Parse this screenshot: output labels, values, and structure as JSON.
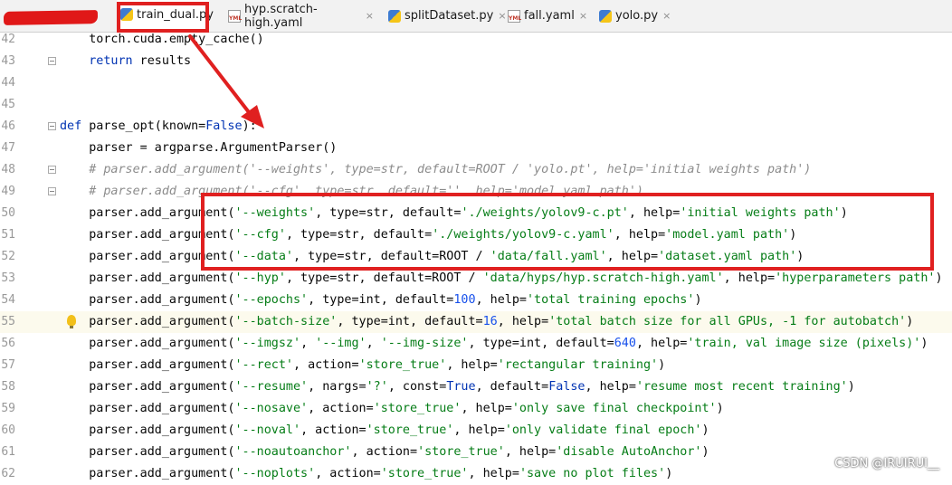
{
  "tabs": [
    {
      "label": "train_dual.py",
      "type": "py",
      "active": true
    },
    {
      "label": "hyp.scratch-high.yaml",
      "type": "yaml",
      "active": false
    },
    {
      "label": "splitDataset.py",
      "type": "py",
      "active": false
    },
    {
      "label": "fall.yaml",
      "type": "yaml",
      "active": false
    },
    {
      "label": "yolo.py",
      "type": "py",
      "active": false
    }
  ],
  "tab_close_glyph": "×",
  "yaml_icon_text": "YML",
  "lines": [
    {
      "n": "42",
      "indent": "    ",
      "tokens": [
        [
          "t",
          "torch.cuda.empty_cache()"
        ]
      ]
    },
    {
      "n": "43",
      "indent": "    ",
      "fold": true,
      "tokens": [
        [
          "kw",
          "return"
        ],
        [
          "t",
          " results"
        ]
      ]
    },
    {
      "n": "44",
      "indent": "",
      "tokens": []
    },
    {
      "n": "45",
      "indent": "",
      "tokens": []
    },
    {
      "n": "46",
      "indent": "",
      "fold": true,
      "tokens": [
        [
          "kw",
          "def"
        ],
        [
          "t",
          " parse_opt(known="
        ],
        [
          "kw",
          "False"
        ],
        [
          "t",
          "):"
        ]
      ]
    },
    {
      "n": "47",
      "indent": "    ",
      "tokens": [
        [
          "t",
          "parser = argparse.ArgumentParser()"
        ]
      ]
    },
    {
      "n": "48",
      "indent": "    ",
      "fold": true,
      "tokens": [
        [
          "cmt",
          "# parser.add_argument('--weights', type=str, default=ROOT / 'yolo.pt', help='initial weights path')"
        ]
      ]
    },
    {
      "n": "49",
      "indent": "    ",
      "fold": true,
      "tokens": [
        [
          "cmt",
          "# parser.add_argument('--cfg', type=str, default='', help='model.yaml path')"
        ]
      ]
    },
    {
      "n": "50",
      "indent": "    ",
      "tokens": [
        [
          "t",
          "parser.add_argument("
        ],
        [
          "str",
          "'--weights'"
        ],
        [
          "t",
          ", type=str, default="
        ],
        [
          "str",
          "'./weights/yolov9-c.pt'"
        ],
        [
          "t",
          ", help="
        ],
        [
          "str",
          "'initial weights path'"
        ],
        [
          "t",
          ")"
        ]
      ]
    },
    {
      "n": "51",
      "indent": "    ",
      "tokens": [
        [
          "t",
          "parser.add_argument("
        ],
        [
          "str",
          "'--cfg'"
        ],
        [
          "t",
          ", type=str, default="
        ],
        [
          "str",
          "'./weights/yolov9-c.yaml'"
        ],
        [
          "t",
          ", help="
        ],
        [
          "str",
          "'model.yaml path'"
        ],
        [
          "t",
          ")"
        ]
      ]
    },
    {
      "n": "52",
      "indent": "    ",
      "tokens": [
        [
          "t",
          "parser.add_argument("
        ],
        [
          "str",
          "'--data'"
        ],
        [
          "t",
          ", type=str, default=ROOT / "
        ],
        [
          "str",
          "'data/fall.yaml'"
        ],
        [
          "t",
          ", help="
        ],
        [
          "str",
          "'dataset.yaml path'"
        ],
        [
          "t",
          ")"
        ]
      ]
    },
    {
      "n": "53",
      "indent": "    ",
      "tokens": [
        [
          "t",
          "parser.add_argument("
        ],
        [
          "str",
          "'--hyp'"
        ],
        [
          "t",
          ", type=str, default=ROOT / "
        ],
        [
          "str",
          "'data/hyps/hyp.scratch-high.yaml'"
        ],
        [
          "t",
          ", help="
        ],
        [
          "str",
          "'hyperparameters path'"
        ],
        [
          "t",
          ")"
        ]
      ]
    },
    {
      "n": "54",
      "indent": "    ",
      "tokens": [
        [
          "t",
          "parser.add_argument("
        ],
        [
          "str",
          "'--epochs'"
        ],
        [
          "t",
          ", type=int, default="
        ],
        [
          "num",
          "100"
        ],
        [
          "t",
          ", help="
        ],
        [
          "str",
          "'total training epochs'"
        ],
        [
          "t",
          ")"
        ]
      ]
    },
    {
      "n": "55",
      "indent": "    ",
      "current": true,
      "bulb": true,
      "tokens": [
        [
          "t",
          "parser.add_argument("
        ],
        [
          "str",
          "'--batch-size'"
        ],
        [
          "t",
          ", type=int, default="
        ],
        [
          "num",
          "16"
        ],
        [
          "t",
          ", help="
        ],
        [
          "str",
          "'total batch size for all GPUs, -1 for autobatch'"
        ],
        [
          "t",
          ")"
        ]
      ]
    },
    {
      "n": "56",
      "indent": "    ",
      "tokens": [
        [
          "t",
          "parser.add_argument("
        ],
        [
          "str",
          "'--imgsz'"
        ],
        [
          "t",
          ", "
        ],
        [
          "str",
          "'--img'"
        ],
        [
          "t",
          ", "
        ],
        [
          "str",
          "'--img-size'"
        ],
        [
          "t",
          ", type=int, default="
        ],
        [
          "num",
          "640"
        ],
        [
          "t",
          ", help="
        ],
        [
          "str",
          "'train, val image size (pixels)'"
        ],
        [
          "t",
          ")"
        ]
      ]
    },
    {
      "n": "57",
      "indent": "    ",
      "tokens": [
        [
          "t",
          "parser.add_argument("
        ],
        [
          "str",
          "'--rect'"
        ],
        [
          "t",
          ", action="
        ],
        [
          "str",
          "'store_true'"
        ],
        [
          "t",
          ", help="
        ],
        [
          "str",
          "'rectangular training'"
        ],
        [
          "t",
          ")"
        ]
      ]
    },
    {
      "n": "58",
      "indent": "    ",
      "tokens": [
        [
          "t",
          "parser.add_argument("
        ],
        [
          "str",
          "'--resume'"
        ],
        [
          "t",
          ", nargs="
        ],
        [
          "str",
          "'?'"
        ],
        [
          "t",
          ", const="
        ],
        [
          "kw",
          "True"
        ],
        [
          "t",
          ", default="
        ],
        [
          "kw",
          "False"
        ],
        [
          "t",
          ", help="
        ],
        [
          "str",
          "'resume most recent training'"
        ],
        [
          "t",
          ")"
        ]
      ]
    },
    {
      "n": "59",
      "indent": "    ",
      "tokens": [
        [
          "t",
          "parser.add_argument("
        ],
        [
          "str",
          "'--nosave'"
        ],
        [
          "t",
          ", action="
        ],
        [
          "str",
          "'store_true'"
        ],
        [
          "t",
          ", help="
        ],
        [
          "str",
          "'only save final checkpoint'"
        ],
        [
          "t",
          ")"
        ]
      ]
    },
    {
      "n": "60",
      "indent": "    ",
      "tokens": [
        [
          "t",
          "parser.add_argument("
        ],
        [
          "str",
          "'--noval'"
        ],
        [
          "t",
          ", action="
        ],
        [
          "str",
          "'store_true'"
        ],
        [
          "t",
          ", help="
        ],
        [
          "str",
          "'only validate final epoch'"
        ],
        [
          "t",
          ")"
        ]
      ]
    },
    {
      "n": "61",
      "indent": "    ",
      "tokens": [
        [
          "t",
          "parser.add_argument("
        ],
        [
          "str",
          "'--noautoanchor'"
        ],
        [
          "t",
          ", action="
        ],
        [
          "str",
          "'store_true'"
        ],
        [
          "t",
          ", help="
        ],
        [
          "str",
          "'disable AutoAnchor'"
        ],
        [
          "t",
          ")"
        ]
      ]
    },
    {
      "n": "62",
      "indent": "    ",
      "tokens": [
        [
          "t",
          "parser.add_argument("
        ],
        [
          "str",
          "'--noplots'"
        ],
        [
          "t",
          ", action="
        ],
        [
          "str",
          "'store_true'"
        ],
        [
          "t",
          ", help="
        ],
        [
          "str",
          "'save no plot files'"
        ],
        [
          "t",
          ")"
        ]
      ]
    }
  ],
  "watermark": "CSDN @IRUIRUI__",
  "colors": {
    "keyword": "#0033b3",
    "string": "#067d17",
    "number": "#1750eb",
    "comment": "#8c8c8c",
    "annotation": "#e02020",
    "tab_underline": "#4083c9"
  }
}
